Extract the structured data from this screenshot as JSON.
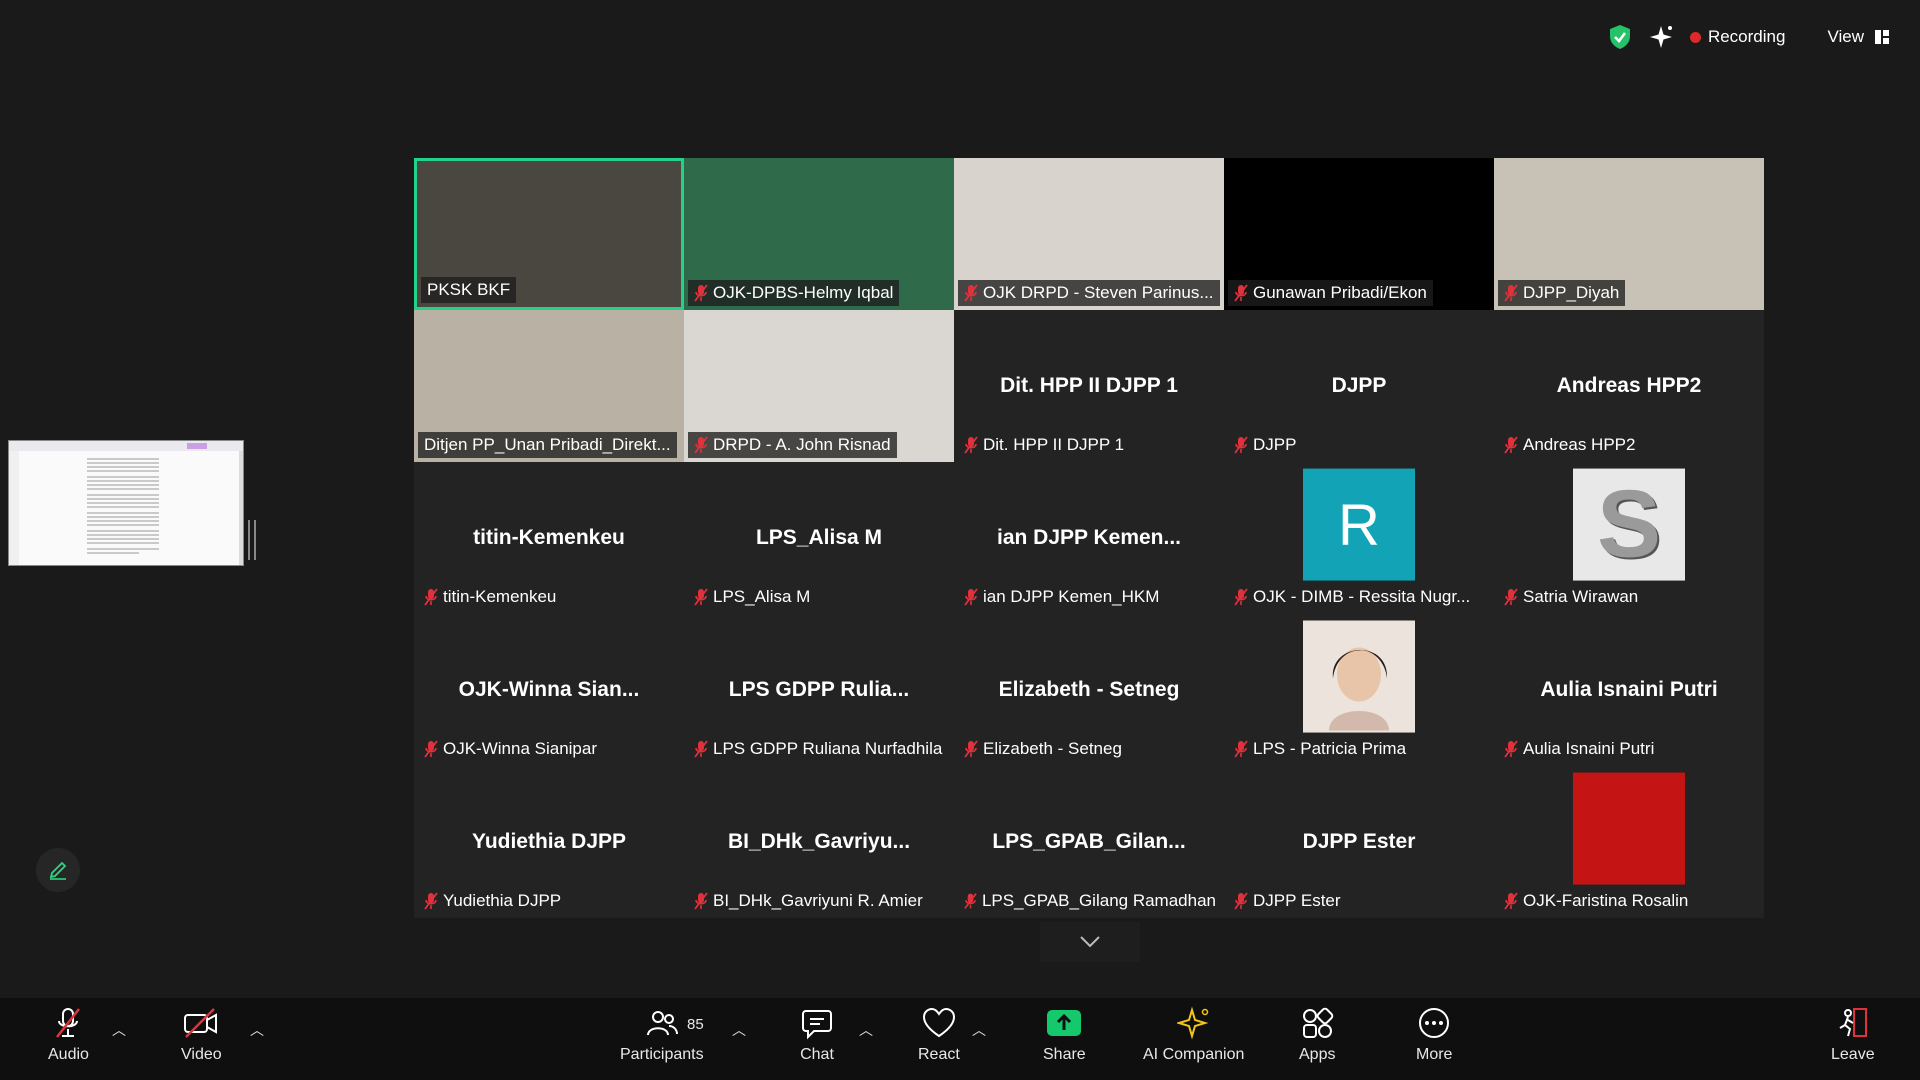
{
  "status": {
    "recording_label": "Recording",
    "view_label": "View"
  },
  "participants": [
    {
      "name": "PKSK BKF",
      "video": true,
      "bg": "#4a4640",
      "active": true,
      "muted": false
    },
    {
      "name": "OJK-DPBS-Helmy Iqbal",
      "video": true,
      "bg": "#2f6b4a",
      "muted": true
    },
    {
      "name": "OJK DRPD - Steven Parinus...",
      "video": true,
      "bg": "#d8d3cc",
      "muted": true
    },
    {
      "name": "Gunawan Pribadi/Ekon",
      "video": true,
      "bg": "#000000",
      "muted": true
    },
    {
      "name": "DJPP_Diyah",
      "video": true,
      "bg": "#c7c2b5",
      "muted": true
    },
    {
      "name": "Ditjen PP_Unan Pribadi_Direkt...",
      "video": true,
      "bg": "#b9b2a4",
      "muted": false
    },
    {
      "name": "DRPD - A. John Risnad",
      "video": true,
      "bg": "#dad6d1",
      "muted": true
    },
    {
      "display": "Dit. HPP II DJPP 1",
      "name": "Dit. HPP II DJPP 1",
      "muted": true
    },
    {
      "display": "DJPP",
      "name": "DJPP",
      "muted": true
    },
    {
      "display": "Andreas HPP2",
      "name": "Andreas HPP2",
      "muted": true
    },
    {
      "display": "titin-Kemenkeu",
      "name": "titin-Kemenkeu",
      "muted": true
    },
    {
      "display": "LPS_Alisa M",
      "name": "LPS_Alisa M",
      "muted": true
    },
    {
      "display": "ian DJPP Kemen...",
      "name": "ian DJPP Kemen_HKM",
      "muted": true
    },
    {
      "avatar": "letter",
      "letter": "R",
      "avatar_color": "#13a3b6",
      "name": "OJK - DIMB - Ressita Nugr...",
      "muted": true
    },
    {
      "avatar": "letter-s",
      "letter": "S",
      "avatar_color": "#e8e8e8",
      "name": "Satria Wirawan",
      "muted": true
    },
    {
      "display": "OJK-Winna  Sian...",
      "name": "OJK-Winna Sianipar",
      "muted": true
    },
    {
      "display": "LPS  GDPP Rulia...",
      "name": "LPS GDPP Ruliana Nurfadhila",
      "muted": true
    },
    {
      "display": "Elizabeth - Setneg",
      "name": "Elizabeth - Setneg",
      "muted": true
    },
    {
      "avatar": "photo",
      "avatar_color": "#e9dfd8",
      "name": "LPS - Patricia Prima",
      "muted": true
    },
    {
      "display": "Aulia Isnaini Putri",
      "name": "Aulia Isnaini Putri",
      "muted": true
    },
    {
      "display": "Yudiethia DJPP",
      "name": "Yudiethia DJPP",
      "muted": true
    },
    {
      "display": "BI_DHk_Gavriyu...",
      "name": "BI_DHk_Gavriyuni R. Amier",
      "muted": true
    },
    {
      "display": "LPS_GPAB_Gilan...",
      "name": "LPS_GPAB_Gilang Ramadhan",
      "muted": true
    },
    {
      "display": "DJPP Ester",
      "name": "DJPP Ester",
      "muted": true
    },
    {
      "avatar": "solid",
      "avatar_color": "#c41414",
      "name": "OJK-Faristina Rosalin",
      "muted": true
    }
  ],
  "toolbar": {
    "audio": "Audio",
    "video": "Video",
    "participants": "Participants",
    "participant_count": "85",
    "chat": "Chat",
    "react": "React",
    "share": "Share",
    "ai": "AI Companion",
    "apps": "Apps",
    "more": "More",
    "leave": "Leave"
  }
}
